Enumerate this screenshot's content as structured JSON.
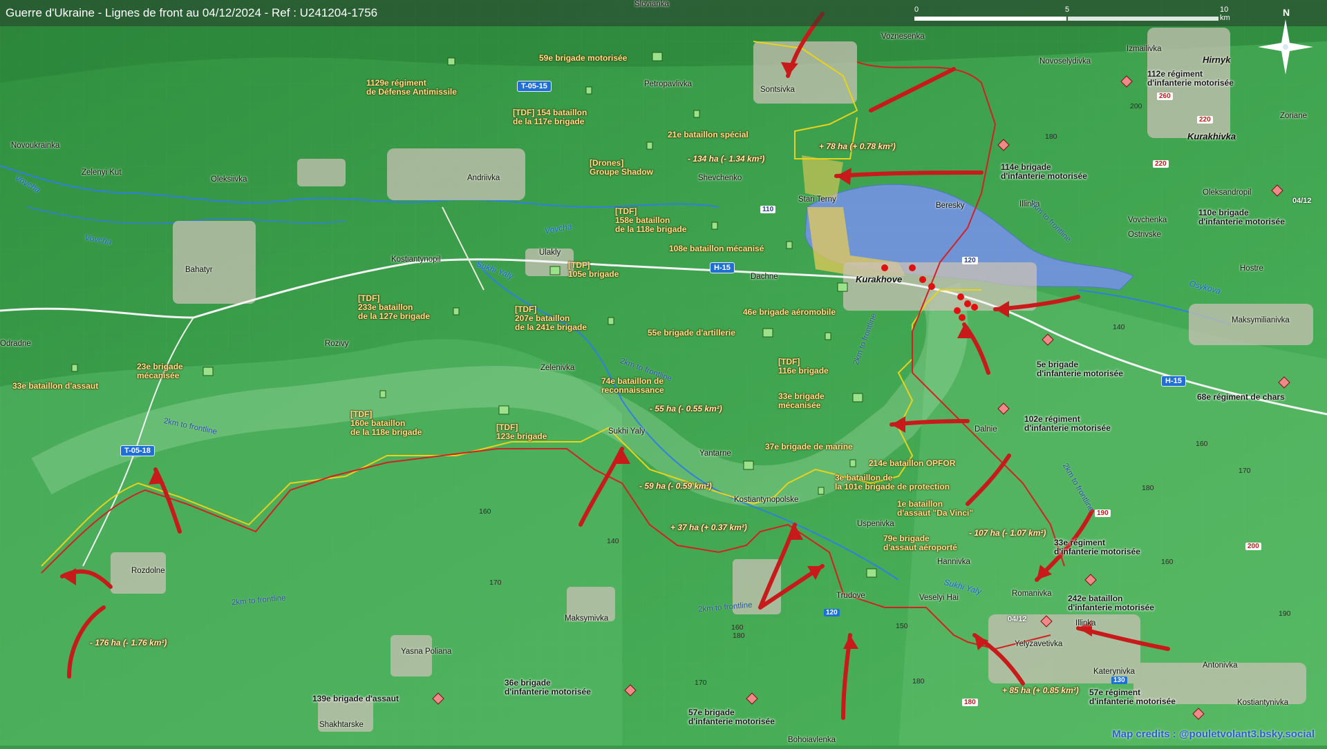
{
  "map": {
    "title": "Guerre d'Ukraine - Lignes de front au 04/12/2024 - Ref : U241204-1756",
    "scale": {
      "zero": "0",
      "mid": "5",
      "end": "10 km"
    },
    "compass_label": "N",
    "credits": "Map credits : @pouletvolant3.bsky.social",
    "date_markers": [
      "04/12",
      "04/12"
    ]
  },
  "colors": {
    "ukraine_line": "#e8d21a",
    "russia_line": "#d42020",
    "arrow": "#c81a1a",
    "water": "#6f94d6",
    "gain": "#e6c95a",
    "buffer": "#c8f0c8"
  },
  "road_shields": [
    "T-05-15",
    "H-15",
    "T-05-18",
    "H-15"
  ],
  "road_numbers": [
    "110",
    "120",
    "120",
    "130",
    "220",
    "220",
    "260",
    "190",
    "200",
    "180"
  ],
  "ukrainian_units": [
    "59e brigade motorisée",
    "1129e régiment\nde Défense Antimissile",
    "[TDF] 154 bataillon\nde la 117e brigade",
    "21e bataillon spécial",
    "[Drones]\nGroupe Shadow",
    "[TDF]\n158e bataillon\nde la 118e brigade",
    "108e bataillon mécanisé",
    "[TDF]\n105e brigade",
    "[TDF]\n233e bataillon\nde la 127e brigade",
    "[TDF]\n207e bataillon\nde la 241e brigade",
    "46e brigade aéromobile",
    "55e brigade d'artillerie",
    "[TDF]\n116e brigade",
    "23e brigade\nmécanisée",
    "33e bataillon d'assaut",
    "74e bataillon de\nreconnaissance",
    "33e brigade\nmécanisée",
    "[TDF]\n160e bataillon\nde la 118e brigade",
    "[TDF]\n123e brigade",
    "37e brigade de marine",
    "214e bataillon OPFOR",
    "3e bataillon de\nla 101e brigade de protection",
    "1e bataillon\nd'assaut \"Da Vinci\"",
    "79e brigade\nd'assaut aéroporté"
  ],
  "russian_units": [
    "112e régiment\nd'infanterie motorisée",
    "114e brigade\nd'infanterie motorisée",
    "110e brigade\nd'infanterie motorisée",
    "5e brigade\nd'infanterie motorisée",
    "68e régiment de chars",
    "102e régiment\nd'infanterie motorisée",
    "33e régiment\nd'infanterie motorisée",
    "242e bataillon\nd'infanterie motorisée",
    "57e régiment\nd'infanterie motorisée",
    "139e brigade d'assaut",
    "36e brigade\nd'infanterie motorisée",
    "57e brigade\nd'infanterie motorisée"
  ],
  "territory_changes": [
    "- 134 ha (- 1.34 km²)",
    "+ 78 ha (+ 0.78 km²)",
    "- 55 ha (- 0.55 km²)",
    "- 59 ha (- 0.59 km²)",
    "+ 37 ha (+ 0.37 km²)",
    "- 107 ha (- 1.07 km²)",
    "+ 85 ha (+ 0.85 km²)",
    "- 176 ha (- 1.76 km²)"
  ],
  "places": [
    "Slovianka",
    "Voznesenka",
    "Novoselydivka",
    "Izmailivka",
    "Hirnyk",
    "Petropavlivka",
    "Sontsivka",
    "Novoukrainka",
    "Zelenyi Kut",
    "Oleksiivka",
    "Andriivka",
    "Shevchenko",
    "Stari Terny",
    "Beresky",
    "Illinka",
    "Oleksandropil",
    "Zoriane",
    "Vovchenka",
    "Ostrivske",
    "Bahatyr",
    "Kostiantynopil",
    "Ulakly",
    "Dachne",
    "Hostre",
    "Maksymilianivka",
    "Rozivy",
    "Zelenivka",
    "Sukhi Yaly",
    "Yantarne",
    "Dalnie",
    "Kostiantynopolske",
    "Uspenivka",
    "Hannivka",
    "Rozdolne",
    "Maksymivka",
    "Trudove",
    "Veselyi Hai",
    "Romanivka",
    "Illinka",
    "Yelyzavetivka",
    "Antonivka",
    "Katerynivka",
    "Kostiantynivka",
    "Yasna Poliana",
    "Shakhtarske",
    "Odradne",
    "Bohoiavlenka"
  ],
  "major_places": [
    "Kurakhove",
    "Kurakhivka"
  ],
  "rivers": [
    "Vovcha",
    "Vovcha",
    "Vovcha",
    "Sukhi Yaly",
    "Sukhi Yaly",
    "Osykova"
  ],
  "buffer_labels": [
    "2km to frontline",
    "2km to frontline",
    "2km to frontline",
    "2km to frontline",
    "2km to frontline",
    "2km to frontline",
    "2km to frontline"
  ],
  "elevations": [
    "200",
    "180",
    "140",
    "160",
    "160",
    "170",
    "180",
    "160",
    "140",
    "170",
    "150",
    "160",
    "170",
    "190",
    "180",
    "160"
  ]
}
